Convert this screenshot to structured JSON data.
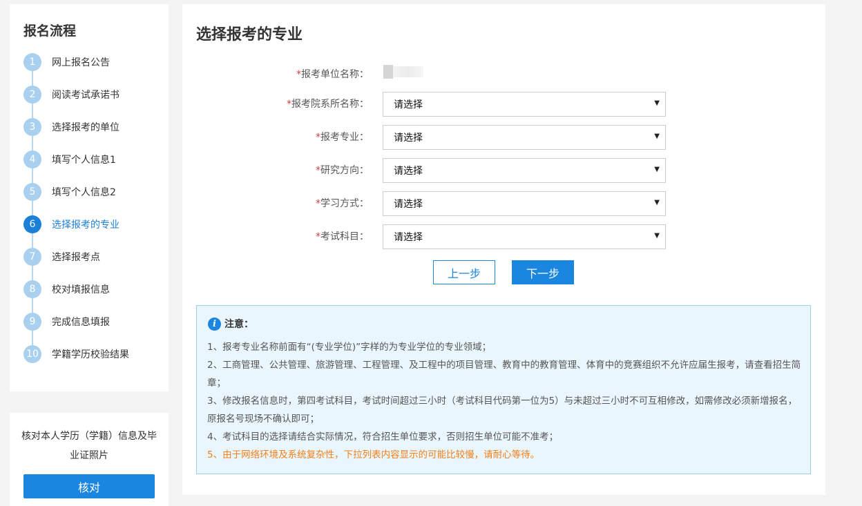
{
  "sidebar": {
    "title": "报名流程",
    "steps": [
      {
        "num": "1",
        "label": "网上报名公告"
      },
      {
        "num": "2",
        "label": "阅读考试承诺书"
      },
      {
        "num": "3",
        "label": "选择报考的单位"
      },
      {
        "num": "4",
        "label": "填写个人信息1"
      },
      {
        "num": "5",
        "label": "填写个人信息2"
      },
      {
        "num": "6",
        "label": "选择报考的专业"
      },
      {
        "num": "7",
        "label": "选择报考点"
      },
      {
        "num": "8",
        "label": "校对填报信息"
      },
      {
        "num": "9",
        "label": "完成信息填报"
      },
      {
        "num": "10",
        "label": "学籍学历校验结果"
      }
    ],
    "active_step": 6
  },
  "verify": {
    "text": "核对本人学历（学籍）信息及毕业证照片",
    "button": "核对"
  },
  "main": {
    "title": "选择报考的专业",
    "form": {
      "required_mark": "*",
      "unit": {
        "label": "报考单位名称："
      },
      "department": {
        "label": "报考院系所名称：",
        "value": "请选择"
      },
      "major": {
        "label": "报考专业：",
        "value": "请选择"
      },
      "direction": {
        "label": "研究方向：",
        "value": "请选择"
      },
      "study_mode": {
        "label": "学习方式：",
        "value": "请选择"
      },
      "subjects": {
        "label": "考试科目：",
        "value": "请选择"
      }
    },
    "buttons": {
      "prev": "上一步",
      "next": "下一步"
    },
    "notice": {
      "title": "注意：",
      "items": [
        "1、报考专业名称前面有“(专业学位)”字样的为专业学位的专业领域；",
        "2、工商管理、公共管理、旅游管理、工程管理、及工程中的项目管理、教育中的教育管理、体育中的竞赛组织不允许应届生报考，请查看招生简章；",
        "3、修改报名信息时，第四考试科目，考试时间超过三小时（考试科目代码第一位为5）与未超过三小时不可互相修改，如需修改必须新增报名，原报名号现场不确认即可；",
        "4、考试科目的选择请结合实际情况，符合招生单位要求，否则招生单位可能不准考；",
        "5、由于网络环境及系统复杂性，下拉列表内容显示的可能比较慢，请耐心等待。"
      ]
    }
  },
  "colors": {
    "accent": "#1a86e0",
    "step_inactive": "#a9d1ef",
    "warning": "#f0801a",
    "required": "#e53935"
  },
  "icons": {
    "notice": "info-icon",
    "select": "triangle-down-icon"
  }
}
